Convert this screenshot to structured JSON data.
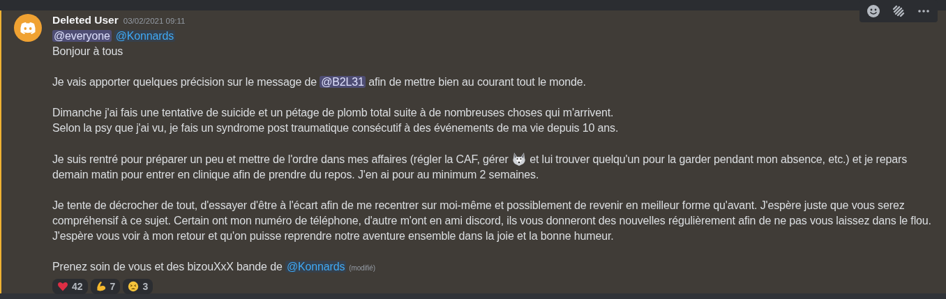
{
  "message": {
    "highlighted": true,
    "author": "Deleted User",
    "timestamp": "03/02/2021 09:11",
    "paragraphs": [
      {
        "lines": [
          [
            {
              "kind": "role",
              "text": "@everyone"
            },
            {
              "kind": "user",
              "text": "@Konnards"
            }
          ],
          [
            {
              "kind": "text",
              "text": "Bonjour à tous"
            }
          ]
        ]
      },
      {
        "lines": [
          [
            {
              "kind": "text",
              "text": "Je vais apporter quelques précision sur le message de "
            },
            {
              "kind": "role",
              "text": "@B2L31"
            },
            {
              "kind": "text",
              "text": " afin de mettre bien au courant tout le monde."
            }
          ]
        ]
      },
      {
        "lines": [
          [
            {
              "kind": "text",
              "text": "Dimanche j'ai fais une tentative de suicide et un pétage de plomb total suite à de nombreuses choses qui m'arrivent."
            }
          ],
          [
            {
              "kind": "text",
              "text": "Selon la psy que j'ai vu, je fais un syndrome post traumatique consécutif à des événements de ma vie depuis 10 ans."
            }
          ]
        ]
      },
      {
        "lines": [
          [
            {
              "kind": "text",
              "text": "Je suis rentré pour préparer un peu et mettre de l'ordre dans mes affaires (régler la CAF, gérer "
            },
            {
              "kind": "emoji"
            },
            {
              "kind": "text",
              "text": " et lui trouver quelqu'un pour la garder pendant mon absence, etc.) et je repars"
            }
          ],
          [
            {
              "kind": "text",
              "text": "demain matin pour entrer en clinique afin de prendre du repos. J'en ai pour au minimum 2 semaines."
            }
          ]
        ]
      },
      {
        "lines": [
          [
            {
              "kind": "text",
              "text": "Je tente de décrocher de tout, d'essayer d'être à l'écart afin de me recentrer sur moi-même et possiblement de revenir en meilleur forme qu'avant. J'espère juste que vous serez"
            }
          ],
          [
            {
              "kind": "text",
              "text": "compréhensif à ce sujet. Certain ont mon numéro de téléphone, d'autre m'ont en ami discord, ils vous donneront des nouvelles régulièrement afin de ne pas vous laissez dans le flou."
            }
          ],
          [
            {
              "kind": "text",
              "text": "J'espère vous voir à mon retour et qu'on puisse reprendre notre aventure ensemble dans la joie et la bonne humeur."
            }
          ]
        ]
      },
      {
        "lines": [
          [
            {
              "kind": "text",
              "text": "Prenez soin de vous et des bizouXxX bande de "
            },
            {
              "kind": "user",
              "text": "@Konnards"
            },
            {
              "kind": "edited",
              "text": "(modifié)"
            }
          ]
        ]
      }
    ],
    "reactions": [
      {
        "kind": "heart",
        "count": "42"
      },
      {
        "kind": "muscle",
        "count": "7"
      },
      {
        "kind": "tired",
        "count": "3"
      }
    ]
  }
}
